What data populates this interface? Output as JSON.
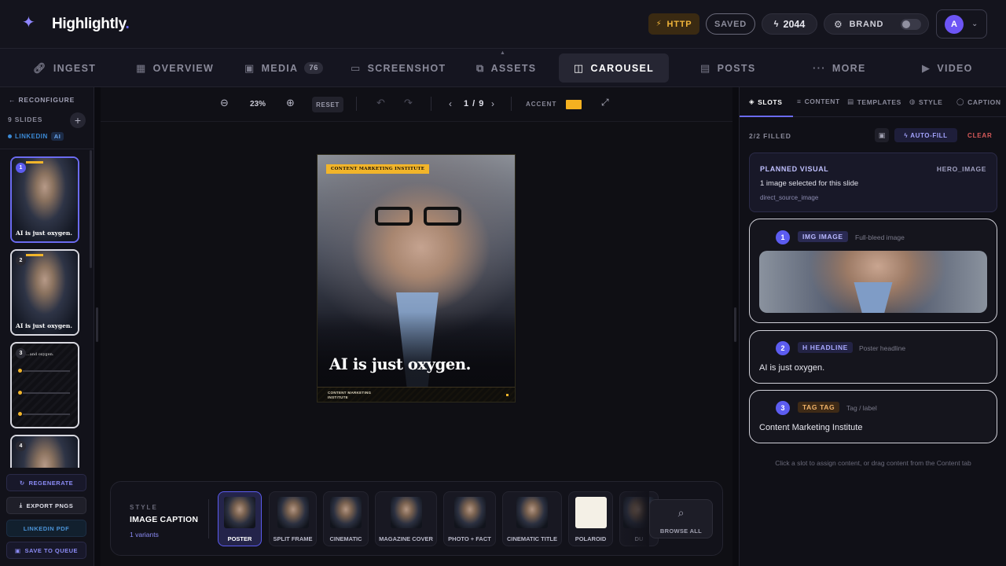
{
  "app": {
    "name": "Highlightly",
    "name_dot": "."
  },
  "header": {
    "http_label": "HTTP",
    "saved_label": "SAVED",
    "credits": "2044",
    "brand_label": "BRAND",
    "avatar_initial": "A"
  },
  "tabs": [
    {
      "label": "INGEST",
      "icon": "link-icon"
    },
    {
      "label": "OVERVIEW",
      "icon": "grid-icon"
    },
    {
      "label": "MEDIA",
      "icon": "image-icon",
      "count": "76"
    },
    {
      "label": "SCREENSHOT",
      "icon": "monitor-icon"
    },
    {
      "label": "ASSETS",
      "icon": "layers-icon"
    },
    {
      "label": "CAROUSEL",
      "icon": "carousel-icon",
      "active": true
    },
    {
      "label": "POSTS",
      "icon": "calendar-icon"
    },
    {
      "label": "MORE",
      "icon": "ellipsis-icon"
    },
    {
      "label": "VIDEO",
      "icon": "video-icon"
    }
  ],
  "sidebar": {
    "reconfigure": "RECONFIGURE",
    "slides_count": "9 SLIDES",
    "platform": "LINKEDIN",
    "ai_badge": "AI",
    "thumbs": [
      {
        "num": "1",
        "text": "AI is just oxygen."
      },
      {
        "num": "2",
        "text": "AI is just oxygen."
      },
      {
        "num": "3",
        "text": "...and oxygen."
      },
      {
        "num": "4",
        "text": ""
      }
    ],
    "buttons": {
      "regenerate": "REGENERATE",
      "export": "EXPORT PNGS",
      "pdf": "LINKEDIN PDF",
      "queue": "SAVE TO QUEUE"
    }
  },
  "toolbar": {
    "zoom": "23%",
    "reset": "RESET",
    "page": "1 / 9",
    "accent_label": "ACCENT",
    "accent_color": "#f4b120"
  },
  "slide": {
    "tag": "CONTENT MARKETING INSTITUTE",
    "headline": "AI is just oxygen.",
    "footer": "CONTENT MARKETING INSTITUTE"
  },
  "style_strip": {
    "label": "STYLE",
    "title": "IMAGE CAPTION",
    "variants": "1 variants",
    "cards": [
      {
        "label": "POSTER",
        "selected": true
      },
      {
        "label": "SPLIT FRAME"
      },
      {
        "label": "CINEMATIC"
      },
      {
        "label": "MAGAZINE COVER"
      },
      {
        "label": "PHOTO + FACT"
      },
      {
        "label": "CINEMATIC TITLE"
      },
      {
        "label": "POLAROID"
      },
      {
        "label": "DU"
      }
    ],
    "browse": "BROWSE ALL"
  },
  "right_panel": {
    "tabs": [
      "SLOTS",
      "CONTENT",
      "TEMPLATES",
      "STYLE",
      "CAPTION"
    ],
    "filled": "2/2 FILLED",
    "autofill": "AUTO-FILL",
    "clear": "CLEAR",
    "planned": {
      "title": "PLANNED VISUAL",
      "kind": "HERO_IMAGE",
      "desc": "1 image selected for this slide",
      "source": "direct_source_image"
    },
    "slots": [
      {
        "num": "1",
        "type": "IMG IMAGE",
        "desc": "Full-bleed image"
      },
      {
        "num": "2",
        "type": "H HEADLINE",
        "desc": "Poster headline",
        "value": "AI is just oxygen."
      },
      {
        "num": "3",
        "type": "TAG TAG",
        "desc": "Tag / label",
        "value": "Content Marketing Institute"
      }
    ],
    "hint": "Click a slot to assign content, or drag content from the Content tab"
  }
}
